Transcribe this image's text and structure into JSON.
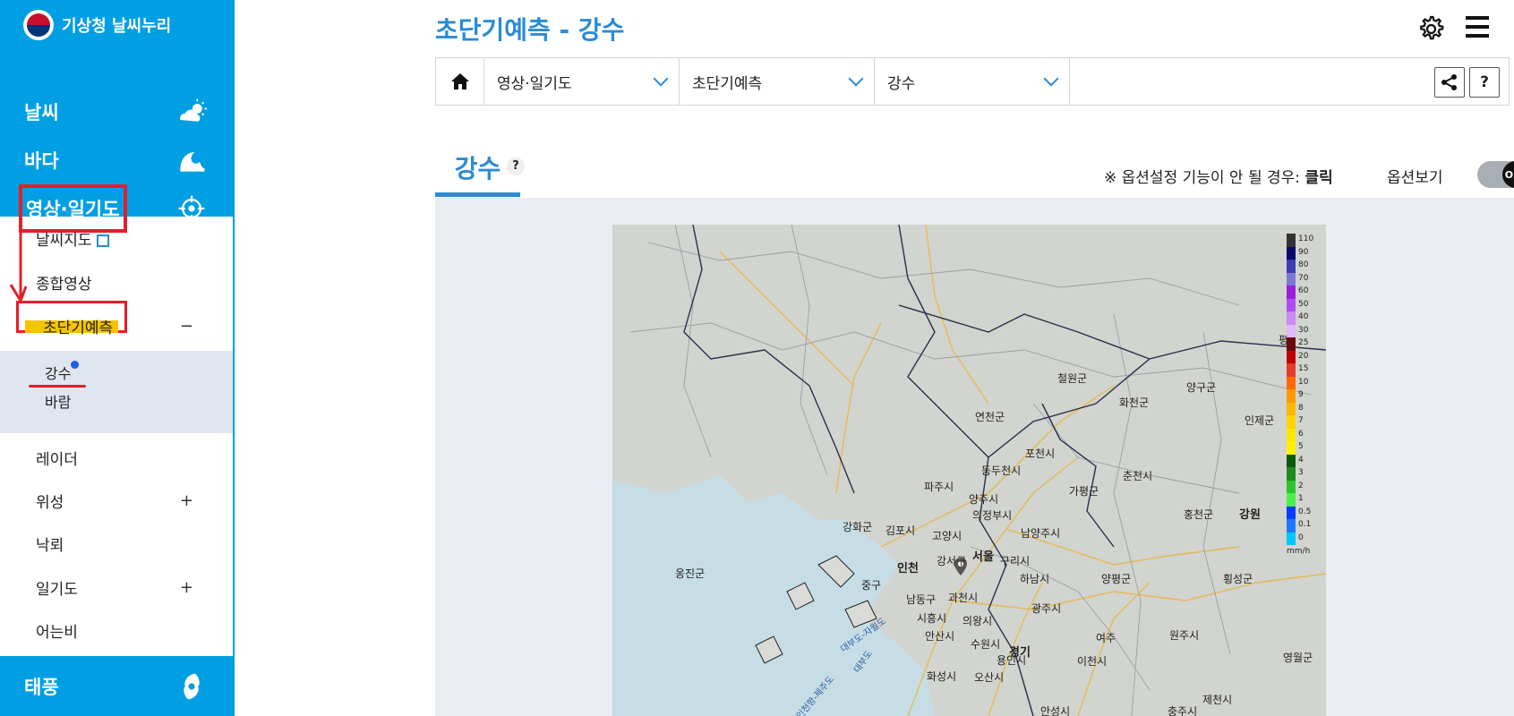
{
  "app": {
    "logo_text": "기상청 날씨누리"
  },
  "sidebar": {
    "categories": {
      "weather": "날씨",
      "sea": "바다",
      "image": "영상·일기도",
      "typhoon": "태풍"
    },
    "items": [
      {
        "label": "날씨지도"
      },
      {
        "label": "종합영상"
      },
      {
        "label": "초단기예측",
        "toggle": "−"
      },
      {
        "label": "레이더"
      },
      {
        "label": "위성",
        "toggle": "+"
      },
      {
        "label": "낙뢰"
      },
      {
        "label": "일기도",
        "toggle": "+"
      },
      {
        "label": "어는비"
      }
    ],
    "subitems": [
      {
        "label": "강수"
      },
      {
        "label": "바람"
      }
    ]
  },
  "header": {
    "title": "초단기예측 - 강수"
  },
  "breadcrumb": {
    "level1": "영상·일기도",
    "level2": "초단기예측",
    "level3": "강수",
    "help_label": "?"
  },
  "tabs": {
    "active": "강수",
    "help": "?"
  },
  "options": {
    "notice_prefix": "※ 옵션설정 기능이 안 될 경우: ",
    "notice_link": "클릭",
    "label": "옵션보기",
    "toggle_state": "OFF"
  },
  "map": {
    "labels": [
      "철원군",
      "화천군",
      "양구군",
      "인제군",
      "연천군",
      "포천시",
      "동두천시",
      "춘천시",
      "파주시",
      "양주시",
      "가평군",
      "의정부시",
      "강화군",
      "김포시",
      "고양시",
      "남양주시",
      "홍천군",
      "강원",
      "서울",
      "구리시",
      "인천",
      "강서구",
      "하남시",
      "양평군",
      "횡성군",
      "옹진군",
      "중구",
      "남동구",
      "과천시",
      "광주시",
      "시흥시",
      "의왕시",
      "원주시",
      "안산시",
      "수원시",
      "여주",
      "경기",
      "용인시",
      "이천시",
      "화성시",
      "오산시",
      "영월군",
      "제천시",
      "안성시",
      "충주시",
      "평창군"
    ],
    "sea_labels": [
      "대부도-자월도",
      "대부도",
      "인천항-제주도"
    ]
  },
  "legend": {
    "levels": [
      "110",
      "90",
      "80",
      "70",
      "60",
      "50",
      "40",
      "30",
      "25",
      "20",
      "15",
      "10",
      "9",
      "8",
      "7",
      "6",
      "5",
      "4",
      "3",
      "2",
      "1",
      "0.5",
      "0.1",
      "0"
    ],
    "colors": [
      "#333333",
      "#0a0a6e",
      "#3c3cb4",
      "#7a7ad6",
      "#9b1fd8",
      "#b24cf0",
      "#c98bf5",
      "#e2b9fa",
      "#6b0a0a",
      "#c00000",
      "#e63a2b",
      "#ff6a00",
      "#ff9a00",
      "#ffb800",
      "#ffd400",
      "#ffe600",
      "#fff200",
      "#0a5a0a",
      "#1e8c1e",
      "#2ec42e",
      "#4cf04c",
      "#0a3cff",
      "#1e78ff",
      "#00c8ff"
    ],
    "unit": "mm/h"
  }
}
